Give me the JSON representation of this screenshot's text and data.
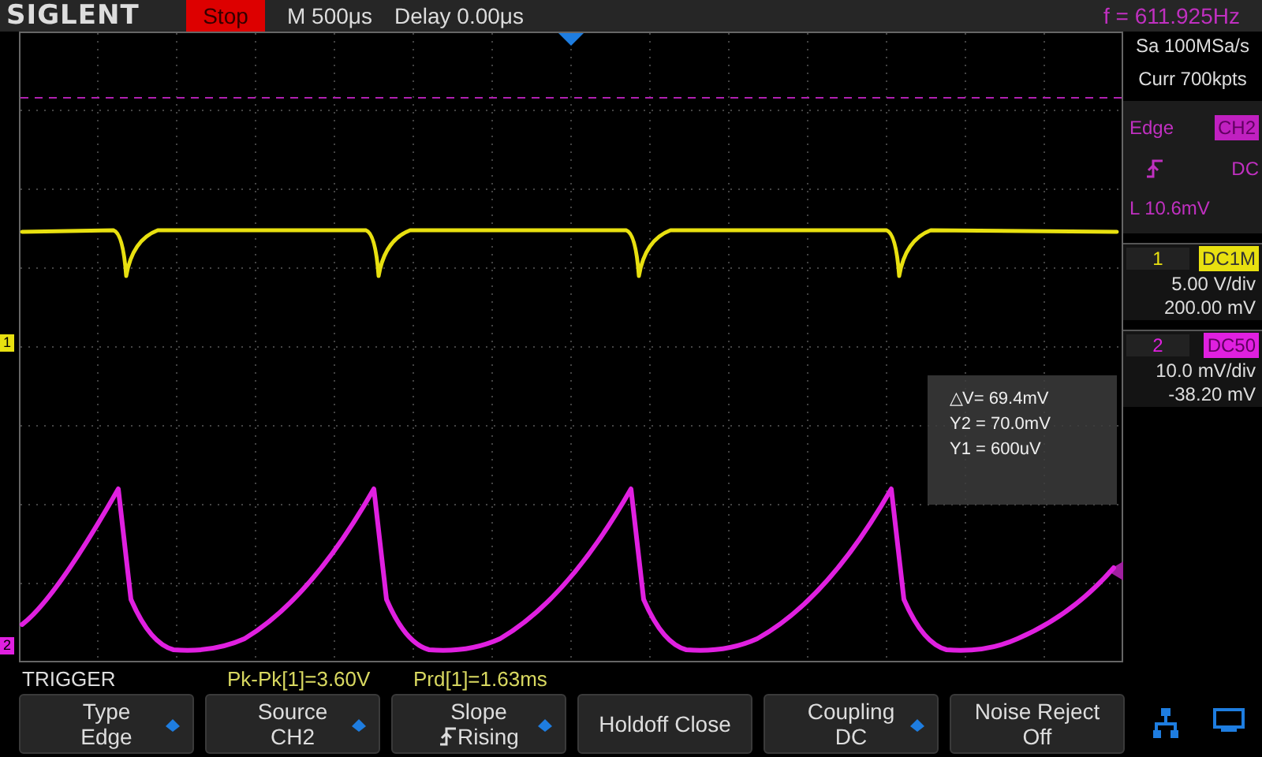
{
  "top_bar": {
    "brand": "SIGLENT",
    "run_state": "Stop",
    "timebase": "M 500μs",
    "delay": "Delay 0.00μs",
    "frequency": "f = 611.925Hz"
  },
  "acquisition": {
    "sample_rate": "Sa 100MSa/s",
    "memory_depth": "Curr 700kpts"
  },
  "trigger_panel": {
    "type": "Edge",
    "source": "CH2",
    "coupling": "DC",
    "level": "L  10.6mV"
  },
  "channels": [
    {
      "number": "1",
      "coupling": "DC1M",
      "scale": "5.00 V/div",
      "offset": "200.00 mV",
      "color": "#e8e010"
    },
    {
      "number": "2",
      "coupling": "DC50",
      "scale": "10.0 mV/div",
      "offset": "-38.20 mV",
      "color": "#e020e0"
    }
  ],
  "channel_markers": [
    {
      "label": "1",
      "color": "#e8e010"
    },
    {
      "label": "2",
      "color": "#e020e0"
    }
  ],
  "cursor_readout": [
    "△V= 69.4mV",
    "Y2 = 70.0mV",
    "Y1 = 600uV"
  ],
  "menu_title": "TRIGGER",
  "measurements": [
    "Pk-Pk[1]=3.60V",
    "Prd[1]=1.63ms"
  ],
  "softkeys": [
    {
      "kind": "pair",
      "label": "Type",
      "value": "Edge",
      "adjustable": true
    },
    {
      "kind": "pair",
      "label": "Source",
      "value": "CH2",
      "adjustable": true
    },
    {
      "kind": "slope",
      "label": "Slope",
      "value": "Rising",
      "adjustable": true
    },
    {
      "kind": "single",
      "label": "Holdoff Close",
      "adjustable": false
    },
    {
      "kind": "pair",
      "label": "Coupling",
      "value": "DC",
      "adjustable": true
    },
    {
      "kind": "pair",
      "label": "Noise Reject",
      "value": "Off",
      "adjustable": false
    }
  ]
}
